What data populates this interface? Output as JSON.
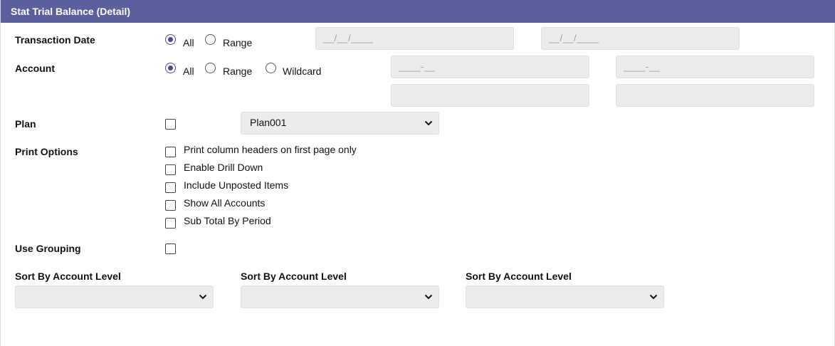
{
  "header": {
    "title": "Stat Trial Balance (Detail)"
  },
  "transaction_date": {
    "label": "Transaction Date",
    "option_all": "All",
    "option_range": "Range",
    "selected": "All",
    "from_placeholder": "__/__/____",
    "to_placeholder": "__/__/____"
  },
  "account": {
    "label": "Account",
    "option_all": "All",
    "option_range": "Range",
    "option_wildcard": "Wildcard",
    "selected": "All",
    "from_placeholder": "____-__",
    "to_placeholder": "____-__",
    "extra_from": "",
    "extra_to": ""
  },
  "plan": {
    "label": "Plan",
    "checked": false,
    "selected_value": "Plan001"
  },
  "print_options": {
    "label": "Print Options",
    "items": [
      {
        "label": "Print column headers on first page only",
        "checked": false
      },
      {
        "label": "Enable Drill Down",
        "checked": false
      },
      {
        "label": "Include Unposted Items",
        "checked": false
      },
      {
        "label": "Show All Accounts",
        "checked": false
      },
      {
        "label": "Sub Total By Period",
        "checked": false
      }
    ]
  },
  "use_grouping": {
    "label": "Use Grouping",
    "checked": false
  },
  "sort": [
    {
      "label": "Sort By Account Level",
      "value": ""
    },
    {
      "label": "Sort By Account Level",
      "value": ""
    },
    {
      "label": "Sort By Account Level",
      "value": ""
    }
  ],
  "colors": {
    "header_bg": "#5b5f9e",
    "field_bg": "#ececec",
    "radio_selected": "#4a4a8a"
  }
}
